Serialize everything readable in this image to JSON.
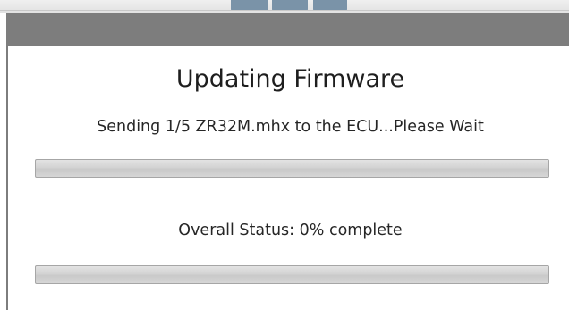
{
  "dialog": {
    "title": "Updating Firmware",
    "file_status": "Sending 1/5 ZR32M.mhx to the ECU...Please Wait",
    "file_progress": 0,
    "overall_status": "Overall Status: 0% complete",
    "overall_progress": 0
  },
  "colors": {
    "titlebar": "#7d7d7d",
    "progress_track": "#d3d3d3",
    "progress_fill": "#3fb83f"
  }
}
